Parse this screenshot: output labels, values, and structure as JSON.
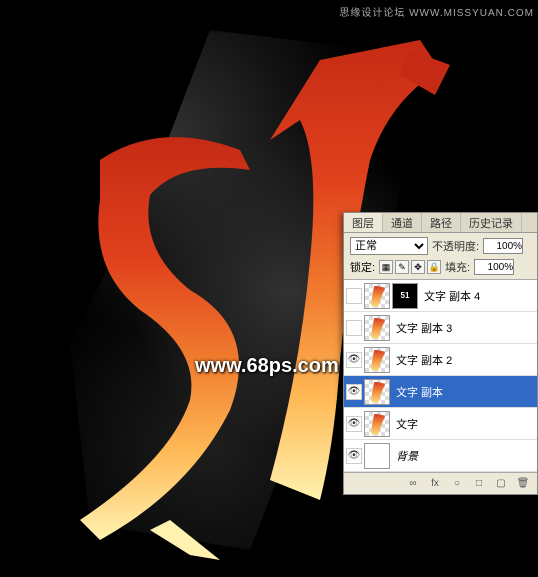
{
  "watermark": {
    "top": "思缘设计论坛  WWW.MISSYUAN.COM",
    "center": "www.68ps.com"
  },
  "artwork": {
    "text": "51"
  },
  "panel": {
    "tabs": [
      "图层",
      "通道",
      "路径",
      "历史记录"
    ],
    "active_tab": 0,
    "blend_mode": "正常",
    "opacity_label": "不透明度:",
    "opacity_value": "100%",
    "lock_label": "锁定:",
    "fill_label": "填充:",
    "fill_value": "100%",
    "layers": [
      {
        "name": "文字 副本 4",
        "visible": false,
        "thumb": "black"
      },
      {
        "name": "文字 副本 3",
        "visible": false,
        "thumb": "art"
      },
      {
        "name": "文字 副本 2",
        "visible": true,
        "thumb": "art"
      },
      {
        "name": "文字 副本",
        "visible": true,
        "thumb": "art",
        "selected": true
      },
      {
        "name": "文字",
        "visible": true,
        "thumb": "art"
      },
      {
        "name": "背景",
        "visible": true,
        "thumb": "white",
        "italic": true
      }
    ],
    "bottom_icons": [
      "∞",
      "fx",
      "○",
      "□",
      "▢",
      "🗑"
    ]
  }
}
